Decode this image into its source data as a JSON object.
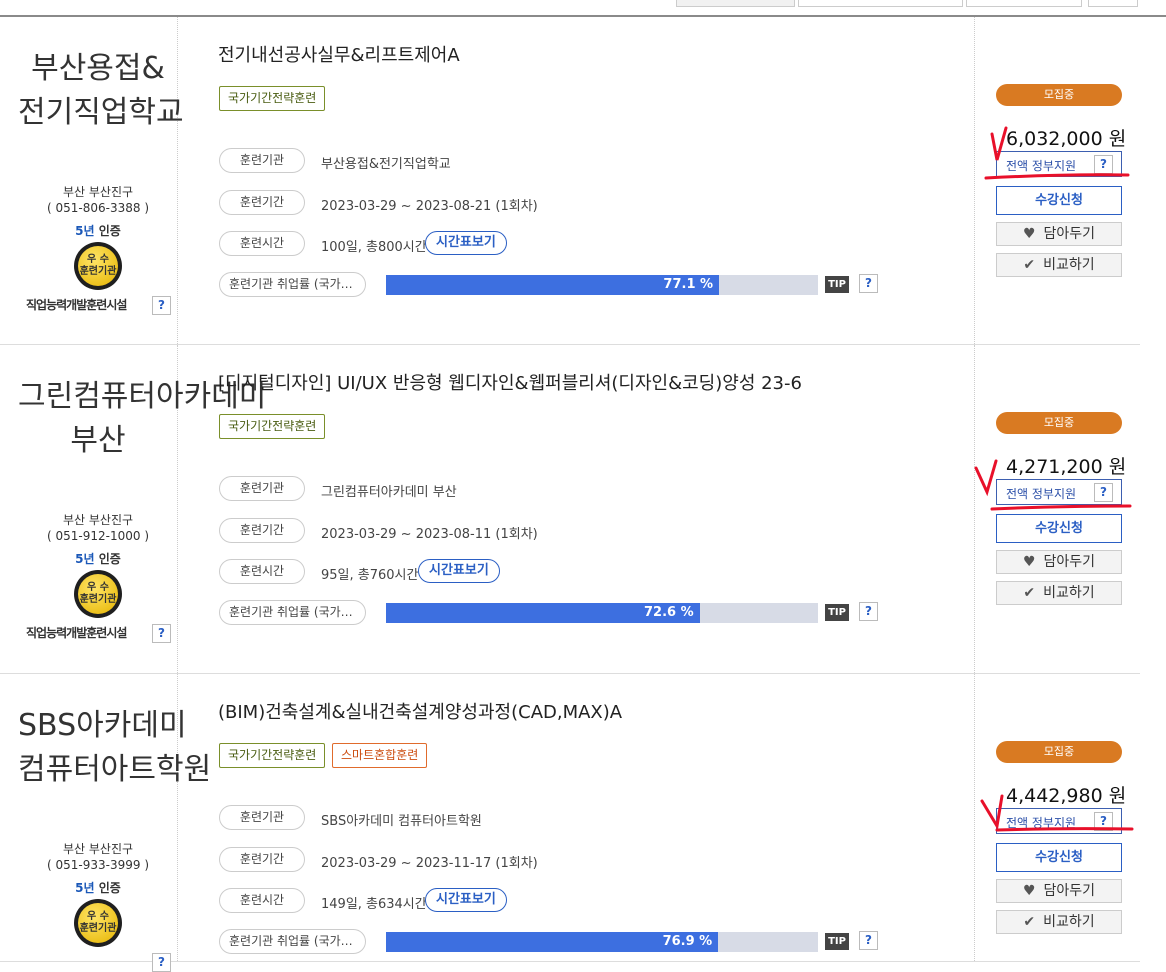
{
  "cards": [
    {
      "name": "부산용접&전기직업학교",
      "region": "부산 부산진구",
      "phone": "( 051-806-3388 )",
      "cert_years": "5년",
      "cert_label": "인증",
      "medal_text": "우 수\n훈련기관",
      "inst_type": "직업능력개발훈련시설",
      "title": "전기내선공사실무&리프트제어A",
      "tags": [
        "국가기간전략훈련"
      ],
      "org_label": "훈련기관",
      "org_value": "부산용접&전기직업학교",
      "period_label": "훈련기간",
      "period_value": "2023-03-29 ~ 2023-08-21 (1회차)",
      "time_label": "훈련시간",
      "time_value": "100일, 총800시간",
      "timetable_btn": "시간표보기",
      "employ_label": "훈련기관 취업률 (국가…",
      "employ_rate": 77.1,
      "employ_text": "77.1 %",
      "tip": "TIP",
      "status": "모집중",
      "price": "6,032,000 원",
      "gov_support": "전액 정부지원",
      "apply": "수강신청",
      "wish": "담아두기",
      "compare": "비교하기"
    },
    {
      "name": "그린컴퓨터아카데미 부산",
      "region": "부산 부산진구",
      "phone": "( 051-912-1000 )",
      "cert_years": "5년",
      "cert_label": "인증",
      "medal_text": "우 수\n훈련기관",
      "inst_type": "직업능력개발훈련시설",
      "title": "[디지털디자인] UI/UX 반응형 웹디자인&웹퍼블리셔(디자인&코딩)양성 23-6",
      "tags": [
        "국가기간전략훈련"
      ],
      "org_label": "훈련기관",
      "org_value": "그린컴퓨터아카데미 부산",
      "period_label": "훈련기간",
      "period_value": "2023-03-29 ~ 2023-08-11 (1회차)",
      "time_label": "훈련시간",
      "time_value": "95일, 총760시간",
      "timetable_btn": "시간표보기",
      "employ_label": "훈련기관 취업률 (국가…",
      "employ_rate": 72.6,
      "employ_text": "72.6 %",
      "tip": "TIP",
      "status": "모집중",
      "price": "4,271,200 원",
      "gov_support": "전액 정부지원",
      "apply": "수강신청",
      "wish": "담아두기",
      "compare": "비교하기"
    },
    {
      "name": "SBS아카데미 컴퓨터아트학원",
      "region": "부산 부산진구",
      "phone": "( 051-933-3999 )",
      "cert_years": "5년",
      "cert_label": "인증",
      "medal_text": "우 수\n훈련기관",
      "inst_type": "",
      "title": "(BIM)건축설계&실내건축설계양성과정(CAD,MAX)A",
      "tags": [
        "국가기간전략훈련",
        "스마트혼합훈련"
      ],
      "org_label": "훈련기관",
      "org_value": "SBS아카데미 컴퓨터아트학원",
      "period_label": "훈련기간",
      "period_value": "2023-03-29 ~ 2023-11-17 (1회차)",
      "time_label": "훈련시간",
      "time_value": "149일, 총634시간",
      "timetable_btn": "시간표보기",
      "employ_label": "훈련기관 취업률 (국가…",
      "employ_rate": 76.9,
      "employ_text": "76.9 %",
      "tip": "TIP",
      "status": "모집중",
      "price": "4,442,980 원",
      "gov_support": "전액 정부지원",
      "apply": "수강신청",
      "wish": "담아두기",
      "compare": "비교하기"
    }
  ],
  "help_glyph": "?",
  "colors": {
    "accent": "#2b5fc4",
    "status": "#d97a22",
    "bar": "#3d6fe0",
    "annotation": "#e8102a"
  },
  "icons": {
    "wish": "heart-icon",
    "compare": "check-icon"
  }
}
